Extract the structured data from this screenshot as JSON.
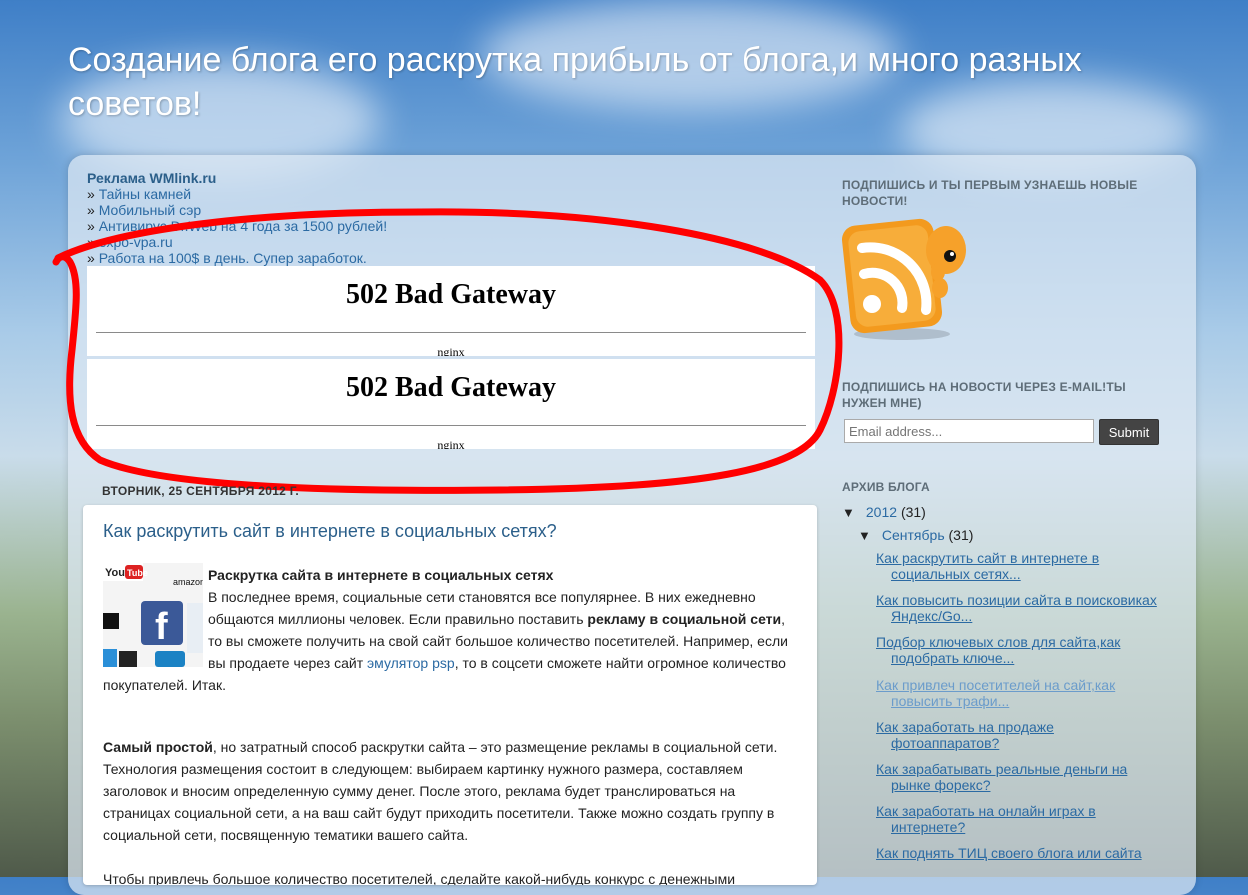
{
  "blog": {
    "title": "Создание блога его раскрутка прибыль от блога,и много разных советов!"
  },
  "ads": {
    "header": "Реклама WMlink.ru",
    "items": [
      {
        "label": "Тайны камней"
      },
      {
        "label": "Мобильный сэр"
      },
      {
        "label": "Антивирус Dr.Web на 4 года за 1500 рублей!"
      },
      {
        "label": "expo-vpa.ru"
      },
      {
        "label": "Работа на 100$ в день. Супер заработок."
      }
    ]
  },
  "errors": [
    {
      "title": "502 Bad Gateway",
      "server": "nginx"
    },
    {
      "title": "502 Bad Gateway",
      "server": "nginx"
    }
  ],
  "post": {
    "date": "ВТОРНИК, 25 СЕНТЯБРЯ 2012 Г.",
    "title": "Как раскрутить сайт в интернете в социальных сетях?",
    "lead_bold": "Раскрутка сайта в интернете в социальных сетях",
    "p1_a": "В последнее время, социальные сети становятся все популярнее. В них ежедневно общаются миллионы человек. Если правильно поставить ",
    "p1_bold": "рекламу в социальной сети",
    "p1_b": ", то вы сможете получить на свой сайт большое количество посетителей. Например, если вы продаете через сайт ",
    "p1_link": "эмулятор psp",
    "p1_c": ", то в соцсети сможете найти огромное количество покупателей. Итак.",
    "p2_bold": "Самый простой",
    "p2_text": ", но затратный способ раскрутки сайта – это размещение рекламы в социальной сети. Технология размещения состоит в следующем: выбираем картинку нужного размера, составляем заголовок и вносим определенную сумму денег. После этого, реклама будет транслироваться на страницах социальной сети, а на ваш сайт будут приходить посетители. Также можно создать группу в социальной сети, посвященную тематики вашего сайта.",
    "p3_text": "Чтобы привлечь большое количество посетителей, сделайте какой-нибудь конкурс с денежными"
  },
  "sidebar": {
    "rss_heading": "ПОДПИШИСЬ И ТЫ ПЕРВЫМ УЗНАЕШЬ НОВЫЕ НОВОСТИ!",
    "email_heading": "ПОДПИШИСЬ НА НОВОСТИ ЧЕРЕЗ E-MAIL!ТЫ НУЖЕН МНЕ)",
    "email_placeholder": "Email address...",
    "submit_label": "Submit",
    "archive_heading": "АРХИВ БЛОГА",
    "archive": {
      "year": "2012",
      "year_count": "(31)",
      "month": "Сентябрь",
      "month_count": "(31)",
      "posts": [
        {
          "l1": "Как раскрутить сайт в интернете в",
          "l2": "социальных сетях..."
        },
        {
          "l1": "Как повысить позиции сайта в поисковиках",
          "l2": "Яндекс/Go..."
        },
        {
          "l1": "Подбор ключевых слов для сайта,как",
          "l2": "подобрать ключе..."
        },
        {
          "l1": "Как привлеч посетителей на сайт,как",
          "l2": "повысить трафи..."
        },
        {
          "l1": "Как заработать на продаже",
          "l2": "фотоаппаратов?"
        },
        {
          "l1": "Как зарабатывать реальные деньги на",
          "l2": "рынке форекс?"
        },
        {
          "l1": "Как заработать на онлайн играх в",
          "l2": "интернете?"
        },
        {
          "l1": "Как поднять ТИЦ своего блога или сайта",
          "l2": ""
        }
      ]
    }
  },
  "colors": {
    "link": "#2b6aa3",
    "annotation": "#ff0000",
    "rss_orange": "#f39a1e"
  }
}
